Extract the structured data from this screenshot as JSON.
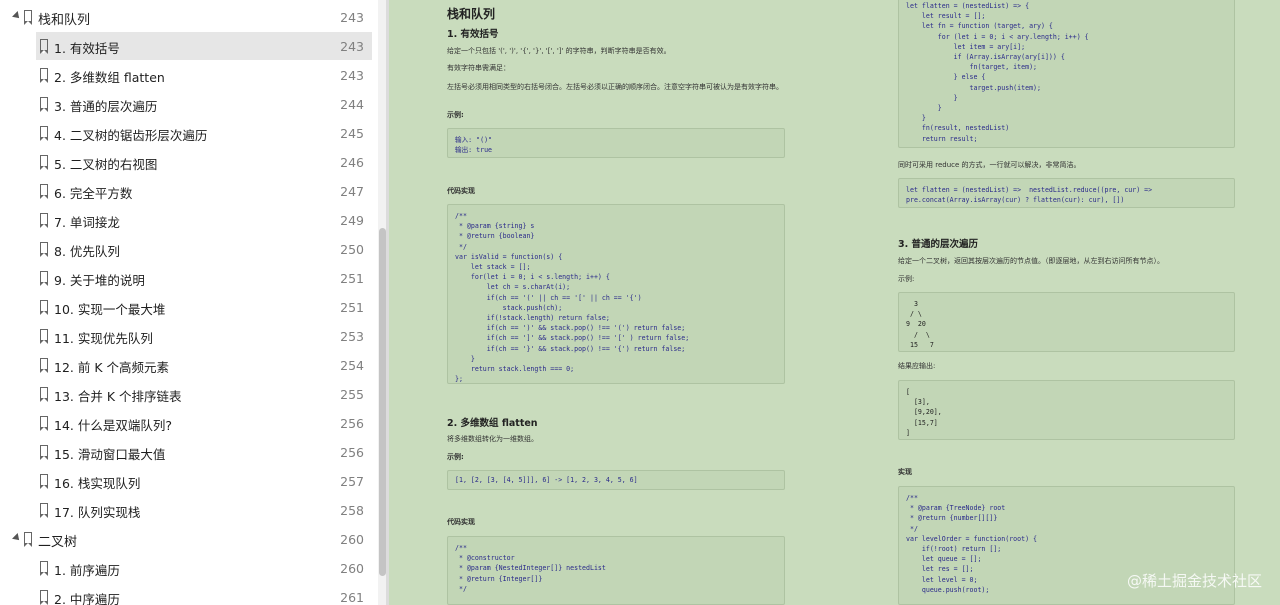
{
  "toc": {
    "items": [
      {
        "type": "chapter",
        "label": "栈和队列",
        "page": "243",
        "selected": false
      },
      {
        "type": "item",
        "label": "1. 有效括号",
        "page": "243",
        "selected": true
      },
      {
        "type": "item",
        "label": "2. 多维数组 flatten",
        "page": "243",
        "selected": false
      },
      {
        "type": "item",
        "label": "3. 普通的层次遍历",
        "page": "244",
        "selected": false
      },
      {
        "type": "item",
        "label": "4. 二叉树的锯齿形层次遍历",
        "page": "245",
        "selected": false
      },
      {
        "type": "item",
        "label": "5. 二叉树的右视图",
        "page": "246",
        "selected": false
      },
      {
        "type": "item",
        "label": "6. 完全平方数",
        "page": "247",
        "selected": false
      },
      {
        "type": "item",
        "label": "7. 单词接龙",
        "page": "249",
        "selected": false
      },
      {
        "type": "item",
        "label": "8. 优先队列",
        "page": "250",
        "selected": false
      },
      {
        "type": "item",
        "label": "9. 关于堆的说明",
        "page": "251",
        "selected": false
      },
      {
        "type": "item",
        "label": "10. 实现一个最大堆",
        "page": "251",
        "selected": false
      },
      {
        "type": "item",
        "label": "11. 实现优先队列",
        "page": "253",
        "selected": false
      },
      {
        "type": "item",
        "label": "12. 前 K 个高频元素",
        "page": "254",
        "selected": false
      },
      {
        "type": "item",
        "label": "13. 合并 K 个排序链表",
        "page": "255",
        "selected": false
      },
      {
        "type": "item",
        "label": "14. 什么是双端队列?",
        "page": "256",
        "selected": false
      },
      {
        "type": "item",
        "label": "15. 滑动窗口最大值",
        "page": "256",
        "selected": false
      },
      {
        "type": "item",
        "label": "16. 栈实现队列",
        "page": "257",
        "selected": false
      },
      {
        "type": "item",
        "label": "17. 队列实现栈",
        "page": "258",
        "selected": false
      },
      {
        "type": "chapter",
        "label": "二叉树",
        "page": "260",
        "selected": false
      },
      {
        "type": "item",
        "label": "1. 前序遍历",
        "page": "260",
        "selected": false
      },
      {
        "type": "item",
        "label": "2. 中序遍历",
        "page": "261",
        "selected": false
      }
    ]
  },
  "doc": {
    "left": {
      "title": "栈和队列",
      "s1_title": "1. 有效括号",
      "s1_p1": "给定一个只包括 '(', ')', '{', '}', '[', ']' 的字符串，判断字符串是否有效。",
      "s1_p2": "有效字符串需满足：",
      "s1_p3": "左括号必须用相同类型的右括号闭合。左括号必须以正确的顺序闭合。注意空字符串可被认为是有效字符串。",
      "s1_example": "示例:",
      "s1_example_code": "输入: \"()\"\n输出: true",
      "s1_impl": "代码实现",
      "s1_code": "/**\n * @param {string} s\n * @return {boolean}\n */\nvar isValid = function(s) {\n    let stack = [];\n    for(let i = 0; i < s.length; i++) {\n        let ch = s.charAt(i);\n        if(ch == '(' || ch == '[' || ch == '{')\n            stack.push(ch);\n        if(!stack.length) return false;\n        if(ch == ')' && stack.pop() !== '(') return false;\n        if(ch == ']' && stack.pop() !== '[' ) return false;\n        if(ch == '}' && stack.pop() !== '{') return false;\n    }\n    return stack.length === 0;\n};",
      "s2_title": "2. 多维数组 flatten",
      "s2_p1": "将多维数组转化为一维数组。",
      "s2_example": "示例:",
      "s2_example_code": "[1, [2, [3, [4, 5]]], 6] -> [1, 2, 3, 4, 5, 6]",
      "s2_impl": "代码实现",
      "s2_code": "/**\n * @constructor\n * @param {NestedInteger[]} nestedList\n * @return {Integer[]}\n */"
    },
    "right": {
      "flatten_code": "let flatten = (nestedList) => {\n    let result = [];\n    let fn = function (target, ary) {\n        for (let i = 0; i < ary.length; i++) {\n            let item = ary[i];\n            if (Array.isArray(ary[i])) {\n                fn(target, item);\n            } else {\n                target.push(item);\n            }\n        }\n    }\n    fn(result, nestedList)\n    return result;",
      "reduce_note": "同时可采用 reduce 的方式，一行就可以解决，非常简洁。",
      "reduce_code": "let flatten = (nestedList) =>  nestedList.reduce((pre, cur) =>\npre.concat(Array.isArray(cur) ? flatten(cur): cur), [])",
      "s3_title": "3. 普通的层次遍历",
      "s3_p1": "给定一个二叉树，返回其按层次遍历的节点值。（即逐层地，从左到右访问所有节点）。",
      "s3_example": "示例:",
      "s3_tree": "  3\n / \\\n9  20\n  /  \\\n 15   7",
      "s3_result_label": "结果应输出:",
      "s3_result": "[\n  [3],\n  [9,20],\n  [15,7]\n]",
      "s3_impl": "实现",
      "s3_code": "/**\n * @param {TreeNode} root\n * @return {number[][]}\n */\nvar levelOrder = function(root) {\n    if(!root) return [];\n    let queue = [];\n    let res = [];\n    let level = 0;\n    queue.push(root);"
    }
  },
  "watermark": "@稀土掘金技术社区"
}
